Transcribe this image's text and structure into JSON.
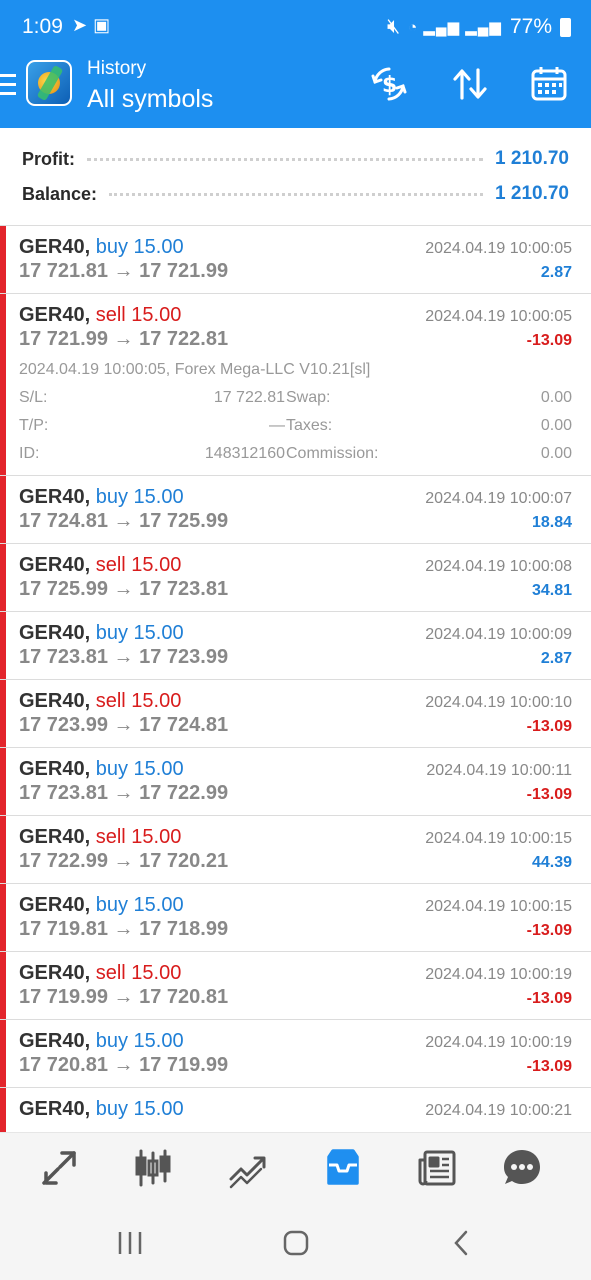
{
  "status": {
    "time": "1:09",
    "battery": "77%"
  },
  "appbar": {
    "title": "History",
    "subtitle": "All symbols"
  },
  "summary": {
    "profit_label": "Profit:",
    "profit_value": "1 210.70",
    "balance_label": "Balance:",
    "balance_value": "1 210.70"
  },
  "deals": [
    {
      "symbol": "GER40,",
      "side": "buy",
      "volume": "buy 15.00",
      "prices": "17 721.81 → 17 721.99",
      "time": "2024.04.19 10:00:05",
      "profit": "2.87"
    },
    {
      "symbol": "GER40,",
      "side": "sell",
      "volume": "sell 15.00",
      "prices": "17 721.99 → 17 722.81",
      "time": "2024.04.19 10:00:05",
      "profit": "-13.09",
      "expanded": {
        "comment": "2024.04.19 10:00:05, Forex Mega-LLC V10.21[sl]",
        "sl_label": "S/L:",
        "sl_value": "17 722.81",
        "swap_label": "Swap:",
        "swap_value": "0.00",
        "tp_label": "T/P:",
        "tp_value": "—",
        "taxes_label": "Taxes:",
        "taxes_value": "0.00",
        "id_label": "ID:",
        "id_value": "148312160",
        "commission_label": "Commission:",
        "commission_value": "0.00"
      }
    },
    {
      "symbol": "GER40,",
      "side": "buy",
      "volume": "buy 15.00",
      "prices": "17 724.81 → 17 725.99",
      "time": "2024.04.19 10:00:07",
      "profit": "18.84"
    },
    {
      "symbol": "GER40,",
      "side": "sell",
      "volume": "sell 15.00",
      "prices": "17 725.99 → 17 723.81",
      "time": "2024.04.19 10:00:08",
      "profit": "34.81"
    },
    {
      "symbol": "GER40,",
      "side": "buy",
      "volume": "buy 15.00",
      "prices": "17 723.81 → 17 723.99",
      "time": "2024.04.19 10:00:09",
      "profit": "2.87"
    },
    {
      "symbol": "GER40,",
      "side": "sell",
      "volume": "sell 15.00",
      "prices": "17 723.99 → 17 724.81",
      "time": "2024.04.19 10:00:10",
      "profit": "-13.09"
    },
    {
      "symbol": "GER40,",
      "side": "buy",
      "volume": "buy 15.00",
      "prices": "17 723.81 → 17 722.99",
      "time": "2024.04.19 10:00:11",
      "profit": "-13.09"
    },
    {
      "symbol": "GER40,",
      "side": "sell",
      "volume": "sell 15.00",
      "prices": "17 722.99 → 17 720.21",
      "time": "2024.04.19 10:00:15",
      "profit": "44.39"
    },
    {
      "symbol": "GER40,",
      "side": "buy",
      "volume": "buy 15.00",
      "prices": "17 719.81 → 17 718.99",
      "time": "2024.04.19 10:00:15",
      "profit": "-13.09"
    },
    {
      "symbol": "GER40,",
      "side": "sell",
      "volume": "sell 15.00",
      "prices": "17 719.99 → 17 720.81",
      "time": "2024.04.19 10:00:19",
      "profit": "-13.09"
    },
    {
      "symbol": "GER40,",
      "side": "buy",
      "volume": "buy 15.00",
      "prices": "17 720.81 → 17 719.99",
      "time": "2024.04.19 10:00:19",
      "profit": "-13.09"
    },
    {
      "symbol": "GER40,",
      "side": "buy",
      "volume": "buy 15.00",
      "prices": "",
      "time": "2024.04.19 10:00:21",
      "profit": ""
    }
  ],
  "icons": {
    "appbar": [
      "currency-exchange-icon",
      "sort-icon",
      "calendar-icon"
    ],
    "bottom_nav": [
      "quotes-icon",
      "chart-icon",
      "trade-icon",
      "history-icon",
      "news-icon",
      "messages-icon"
    ],
    "system_nav": [
      "recent-apps-icon",
      "home-icon",
      "back-icon"
    ]
  },
  "colors": {
    "accent": "#1d8ff0",
    "buy": "#1f7fd6",
    "sell": "#d81c1c",
    "deal_bar": "#e3242b"
  }
}
